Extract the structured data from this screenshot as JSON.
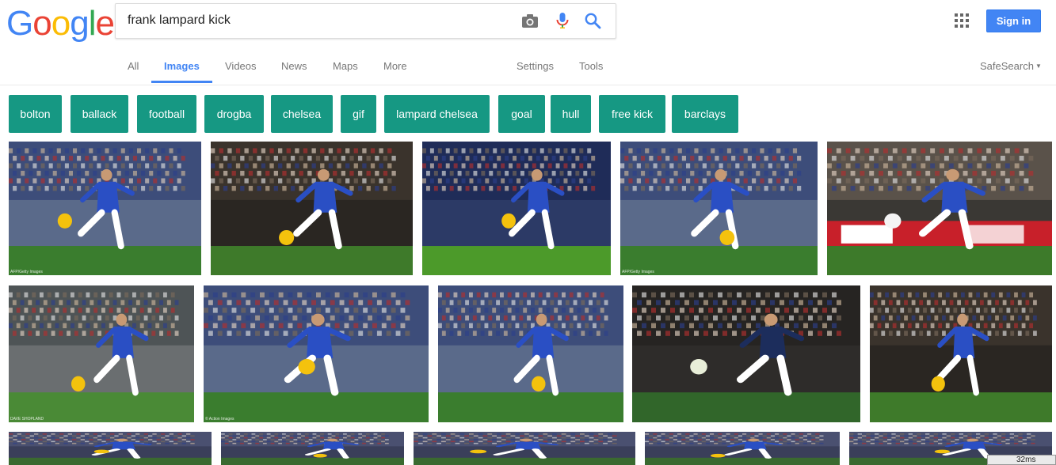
{
  "logo": {
    "letters": [
      "G",
      "o",
      "o",
      "g",
      "l",
      "e"
    ],
    "colors": [
      "#4285f4",
      "#ea4335",
      "#fbbc05",
      "#4285f4",
      "#34a853",
      "#ea4335"
    ]
  },
  "search": {
    "query": "frank lampard kick"
  },
  "header": {
    "signin_label": "Sign in"
  },
  "tabs": {
    "items": [
      "All",
      "Images",
      "Videos",
      "News",
      "Maps",
      "More"
    ],
    "active": "Images",
    "settings": "Settings",
    "tools": "Tools",
    "safesearch": "SafeSearch"
  },
  "chips": [
    "bolton",
    "ballack",
    "football",
    "drogba",
    "chelsea",
    "gif",
    "lampard chelsea",
    "goal",
    "hull",
    "free kick",
    "barclays"
  ],
  "chip_color": "#169883",
  "accent": "#4285f4",
  "results": [
    {
      "kind": "chelsea",
      "watermark": "AFP/Getty Images"
    },
    {
      "kind": "chelsea_dark",
      "watermark": ""
    },
    {
      "kind": "chelsea_pitch",
      "watermark": ""
    },
    {
      "kind": "chelsea",
      "watermark": "AFP/Getty Images"
    },
    {
      "kind": "facup",
      "watermark": ""
    },
    {
      "kind": "chelsea_goal",
      "watermark": "DAVE SHOPLAND"
    },
    {
      "kind": "chelsea",
      "watermark": "© Action Images"
    },
    {
      "kind": "chelsea",
      "watermark": ""
    },
    {
      "kind": "mancity",
      "watermark": ""
    },
    {
      "kind": "chelsea_dark",
      "watermark": ""
    },
    {
      "kind": "row3",
      "watermark": ""
    },
    {
      "kind": "row3",
      "watermark": ""
    },
    {
      "kind": "row3",
      "watermark": ""
    },
    {
      "kind": "row3",
      "watermark": ""
    },
    {
      "kind": "row3",
      "watermark": ""
    }
  ],
  "perf_overlay": "32ms"
}
